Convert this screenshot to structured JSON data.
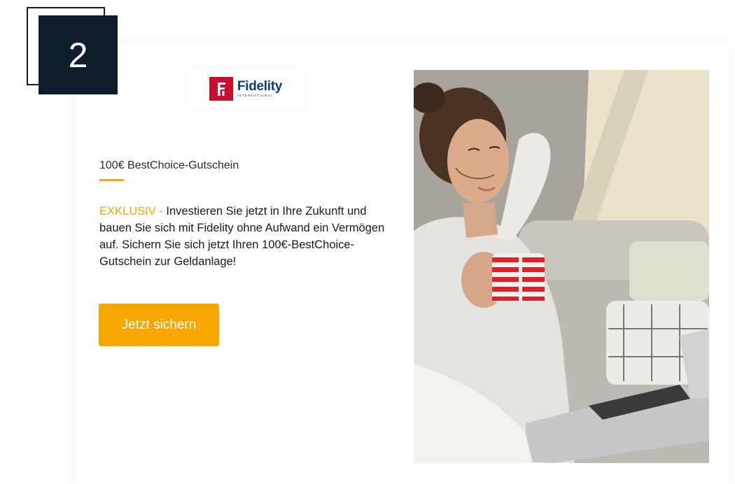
{
  "step": {
    "number": "2"
  },
  "brand": {
    "name": "Fidelity",
    "subline": "INTERNATIONAL",
    "logo_letter": "F",
    "brand_color": "#c8102e",
    "text_color": "#0f3c74"
  },
  "offer": {
    "title": "100€ BestChoice-Gutschein",
    "highlight": "EXKLUSIV -",
    "body": " Investieren Sie jetzt in Ihre Zukunft und bauen Sie sich mit Fidelity ohne Aufwand ein Vermögen auf. Sichern Sie sich jetzt Ihren 100€-BestChoice-Gutschein zur Geldanlage!",
    "cta_label": "Jetzt sichern"
  },
  "colors": {
    "accent": "#f7a700",
    "badge": "#0f1d2c",
    "title_text": "#1c2b44"
  },
  "image": {
    "subject": "woman-relaxing-with-mug-and-laptop"
  }
}
